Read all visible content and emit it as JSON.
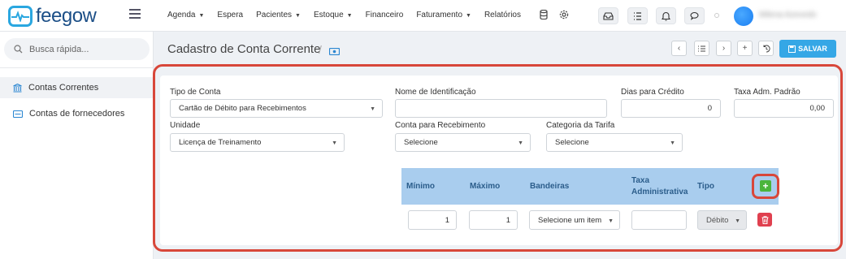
{
  "brand": {
    "name": "feegow"
  },
  "nav": {
    "items": [
      {
        "label": "Agenda",
        "has_caret": true
      },
      {
        "label": "Espera",
        "has_caret": false
      },
      {
        "label": "Pacientes",
        "has_caret": true
      },
      {
        "label": "Estoque",
        "has_caret": true
      },
      {
        "label": "Financeiro",
        "has_caret": false
      },
      {
        "label": "Faturamento",
        "has_caret": true
      },
      {
        "label": "Relatórios",
        "has_caret": false
      }
    ],
    "extra_icons": [
      "database-icon",
      "settings-cog-icon"
    ],
    "toolbar_icons": [
      "inbox-icon",
      "checklist-icon",
      "bell-icon",
      "chat-icon"
    ],
    "user_name": "Milena Azevedo"
  },
  "sidebar": {
    "search_placeholder": "Busca rápida...",
    "items": [
      {
        "label": "Contas Correntes",
        "icon": "bank-icon",
        "active": true
      },
      {
        "label": "Contas de fornecedores",
        "icon": "card-icon",
        "active": false
      }
    ]
  },
  "page": {
    "title": "Cadastro de Conta Corrente",
    "separator": "/",
    "save_label": "SALVAR",
    "header_buttons": [
      "prev-icon",
      "list-icon",
      "next-icon",
      "plus-icon",
      "history-icon"
    ]
  },
  "form": {
    "tipo_conta": {
      "label": "Tipo de Conta",
      "value": "Cartão de Débito para Recebimentos"
    },
    "nome_identificacao": {
      "label": "Nome de Identificação",
      "value": ""
    },
    "dias_credito": {
      "label": "Dias para Crédito",
      "value": "0"
    },
    "taxa_adm": {
      "label": "Taxa Adm. Padrão",
      "value": "0,00"
    },
    "unidade": {
      "label": "Unidade",
      "value": "Licença de Treinamento"
    },
    "conta_recebimento": {
      "label": "Conta para Recebimento",
      "value": "Selecione"
    },
    "categoria_tarifa": {
      "label": "Categoria da Tarifa",
      "value": "Selecione"
    }
  },
  "tiers": {
    "headers": {
      "minimo": "Mínimo",
      "maximo": "Máximo",
      "bandeiras": "Bandeiras",
      "taxa_line1": "Taxa",
      "taxa_line2": "Administrativa",
      "tipo": "Tipo"
    },
    "add_label": "+",
    "row": {
      "minimo": "1",
      "maximo": "1",
      "bandeiras": "Selecione um item",
      "taxa": "",
      "tipo": "Débito"
    }
  },
  "colors": {
    "accent": "#35a7e6",
    "highlight": "#d8473a",
    "table_header": "#a9cdee",
    "add_green": "#4bb53c",
    "delete_red": "#e0404f"
  }
}
